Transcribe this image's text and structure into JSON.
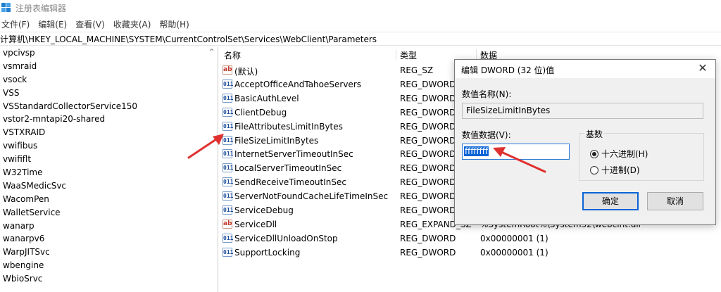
{
  "window": {
    "title": "注册表编辑器"
  },
  "menu": [
    "文件(F)",
    "编辑(E)",
    "查看(V)",
    "收藏夹(A)",
    "帮助(H)"
  ],
  "address": "计算机\\HKEY_LOCAL_MACHINE\\SYSTEM\\CurrentControlSet\\Services\\WebClient\\Parameters",
  "tree": [
    "vpcivsp",
    "vsmraid",
    "vsock",
    "VSS",
    "VSStandardCollectorService150",
    "vstor2-mntapi20-shared",
    "VSTXRAID",
    "vwifibus",
    "vwififlt",
    "W32Time",
    "WaaSMedicSvc",
    "WacomPen",
    "WalletService",
    "wanarp",
    "wanarpv6",
    "WarpJITSvc",
    "wbengine",
    "WbioSrvc"
  ],
  "list": {
    "headers": {
      "name": "名称",
      "type": "类型",
      "data": "数据"
    },
    "rows": [
      {
        "icon": "ab",
        "name": "(默认)",
        "type": "REG_SZ",
        "data": ""
      },
      {
        "icon": "dword",
        "name": "AcceptOfficeAndTahoeServers",
        "type": "REG_DWORD",
        "data": ""
      },
      {
        "icon": "dword",
        "name": "BasicAuthLevel",
        "type": "REG_DWORD",
        "data": ""
      },
      {
        "icon": "dword",
        "name": "ClientDebug",
        "type": "REG_DWORD",
        "data": ""
      },
      {
        "icon": "dword",
        "name": "FileAttributesLimitInBytes",
        "type": "REG_DWORD",
        "data": ""
      },
      {
        "icon": "dword",
        "name": "FileSizeLimitInBytes",
        "type": "REG_DWORD",
        "data": ""
      },
      {
        "icon": "dword",
        "name": "InternetServerTimeoutInSec",
        "type": "REG_DWORD",
        "data": ""
      },
      {
        "icon": "dword",
        "name": "LocalServerTimeoutInSec",
        "type": "REG_DWORD",
        "data": ""
      },
      {
        "icon": "dword",
        "name": "SendReceiveTimeoutInSec",
        "type": "REG_DWORD",
        "data": ""
      },
      {
        "icon": "dword",
        "name": "ServerNotFoundCacheLifeTimeInSec",
        "type": "REG_DWORD",
        "data": ""
      },
      {
        "icon": "dword",
        "name": "ServiceDebug",
        "type": "REG_DWORD",
        "data": ""
      },
      {
        "icon": "ab",
        "name": "ServiceDll",
        "type": "REG_EXPAND_SZ",
        "data": "%SystemRoot%\\System32\\webclnt.dll"
      },
      {
        "icon": "dword",
        "name": "ServiceDllUnloadOnStop",
        "type": "REG_DWORD",
        "data": "0x00000001 (1)"
      },
      {
        "icon": "dword",
        "name": "SupportLocking",
        "type": "REG_DWORD",
        "data": "0x00000001 (1)"
      }
    ]
  },
  "dialog": {
    "title": "编辑 DWORD (32 位)值",
    "name_label": "数值名称(N):",
    "name_value": "FileSizeLimitInBytes",
    "data_label": "数值数据(V):",
    "data_value": "ffffffff",
    "base_label": "基数",
    "hex_label": "十六进制(H)",
    "dec_label": "十进制(D)",
    "ok_label": "确定",
    "cancel_label": "取消",
    "close_glyph": "✕"
  },
  "icons": {
    "scroll_up": "^",
    "ab": "ab",
    "dword": "011"
  },
  "colors": {
    "accent": "#0a64d6",
    "annotation_arrow": "#e03030"
  }
}
